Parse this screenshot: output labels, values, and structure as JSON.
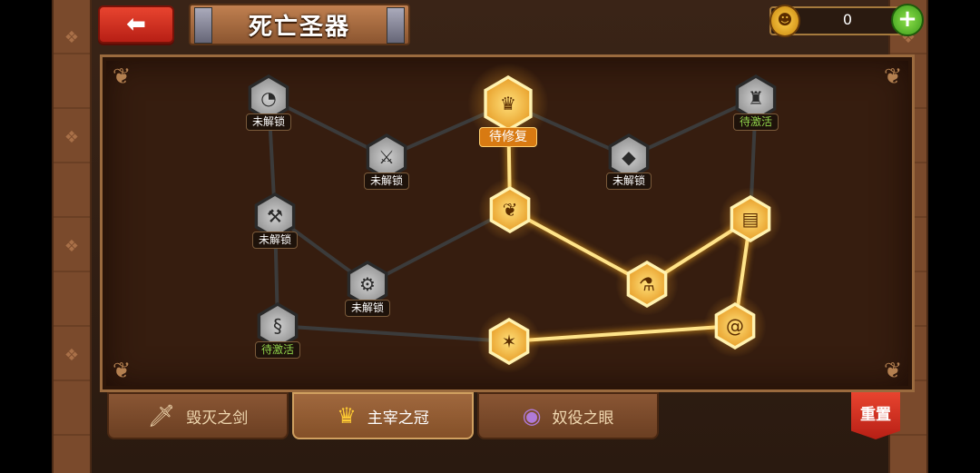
{
  "header": {
    "back_icon": "left-arrow-icon",
    "title": "死亡圣器"
  },
  "currency": {
    "icon": "demon-coin-icon",
    "value": "0",
    "add_icon": "plus-icon"
  },
  "tree": {
    "nodes": [
      {
        "id": "n1",
        "icon": "orb-icon",
        "glyph": "◔",
        "state": "locked",
        "label": "未解锁"
      },
      {
        "id": "n2",
        "icon": "sword-icon",
        "glyph": "⚔",
        "state": "locked",
        "label": "未解锁"
      },
      {
        "id": "n3",
        "icon": "crown-icon",
        "glyph": "♛",
        "state": "active",
        "label": "待修复"
      },
      {
        "id": "n4",
        "icon": "gem-icon",
        "glyph": "◆",
        "state": "locked",
        "label": "未解锁"
      },
      {
        "id": "n5",
        "icon": "castle-icon",
        "glyph": "♜",
        "state": "locked",
        "label": "待激活"
      },
      {
        "id": "n6",
        "icon": "anvil-icon",
        "glyph": "⚒",
        "state": "locked",
        "label": "未解锁"
      },
      {
        "id": "n7",
        "icon": "gear-icon",
        "glyph": "⚙",
        "state": "locked",
        "label": "未解锁"
      },
      {
        "id": "n8",
        "icon": "swirl-icon",
        "glyph": "§",
        "state": "locked",
        "label": "待激活"
      },
      {
        "id": "n9",
        "icon": "leaf-icon",
        "glyph": "❦",
        "state": "active",
        "label": ""
      },
      {
        "id": "n10",
        "icon": "potion-icon",
        "glyph": "⚗",
        "state": "active",
        "label": ""
      },
      {
        "id": "n11",
        "icon": "card-icon",
        "glyph": "▤",
        "state": "active",
        "label": ""
      },
      {
        "id": "n12",
        "icon": "star-sigil-icon",
        "glyph": "✶",
        "state": "active",
        "label": ""
      },
      {
        "id": "n13",
        "icon": "spiral-icon",
        "glyph": "@",
        "state": "active",
        "label": ""
      }
    ]
  },
  "tabs": [
    {
      "label": "毁灭之剑",
      "icon": "sword-icon",
      "glyph": "🗡",
      "selected": false
    },
    {
      "label": "主宰之冠",
      "icon": "crown-icon",
      "glyph": "♛",
      "selected": true
    },
    {
      "label": "奴役之眼",
      "icon": "eye-icon",
      "glyph": "◉",
      "selected": false
    }
  ],
  "reset_label": "重置"
}
